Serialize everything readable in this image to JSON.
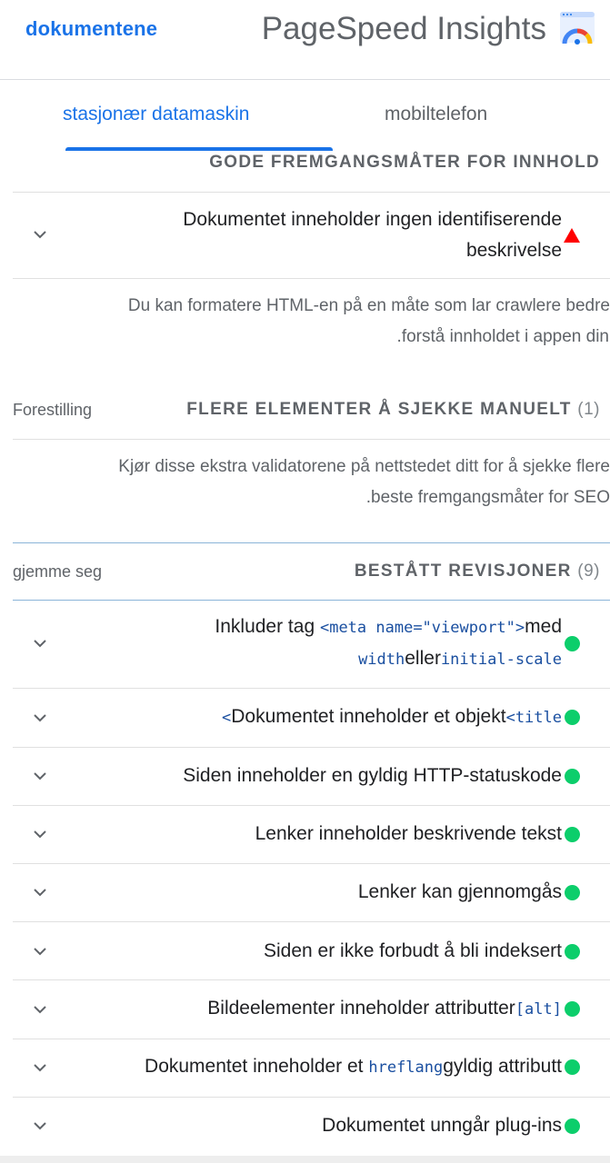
{
  "header": {
    "docs_link": "dokumentene",
    "app_title": "PageSpeed Insights",
    "logo_icon": "pagespeed-gauge-icon"
  },
  "tabs": [
    {
      "label": "stasjonær datamaskin",
      "active": true
    },
    {
      "label": "mobiltelefon",
      "active": false
    }
  ],
  "colors": {
    "accent": "#1a73e8",
    "pass": "#0cce6b",
    "fail": "#ff0000"
  },
  "content_best_practices": {
    "header": "GODE FREMGANGSMÅTER FOR INNHOLD",
    "audit": {
      "title_line1": "Dokumentet inneholder ingen identifiserende",
      "title_line2": "beskrivelse",
      "status": "fail"
    },
    "description_line1": "Du kan formatere HTML-en på en måte som lar crawlere bedre",
    "description_line2": ".forstå innholdet i appen din"
  },
  "manual_checks": {
    "side_label": "Forestilling",
    "header": "FLERE ELEMENTER Å SJEKKE MANUELT",
    "count": "(1)",
    "description_line1": "Kjør disse ekstra validatorene på nettstedet ditt for å sjekke flere",
    "description_line2": ".beste fremgangsmåter for SEO"
  },
  "passed_audits": {
    "side_label": "gjemme seg",
    "header": "BESTÅTT REVISJONER",
    "count": "(9)",
    "items": [
      {
        "pre": "Inkluder tag ",
        "code": "<meta name=\"viewport\">",
        "post": "med",
        "line2_code1": "width",
        "line2_text": "eller",
        "line2_code2": "initial-scale"
      },
      {
        "code_pre": "<",
        "text": "Dokumentet inneholder et objekt",
        "code_post": "<title"
      },
      {
        "text": "Siden inneholder en gyldig HTTP-statuskode"
      },
      {
        "text": "Lenker inneholder beskrivende tekst"
      },
      {
        "text": "Lenker kan gjennomgås"
      },
      {
        "text": "Siden er ikke forbudt å bli indeksert"
      },
      {
        "text": "Bildeelementer inneholder attributter",
        "code_post": "[alt]"
      },
      {
        "text_pre": "Dokumentet inneholder et ",
        "code": "hreflang",
        "text_post": "gyldig attributt"
      },
      {
        "text": "Dokumentet unngår plug-ins"
      }
    ]
  }
}
